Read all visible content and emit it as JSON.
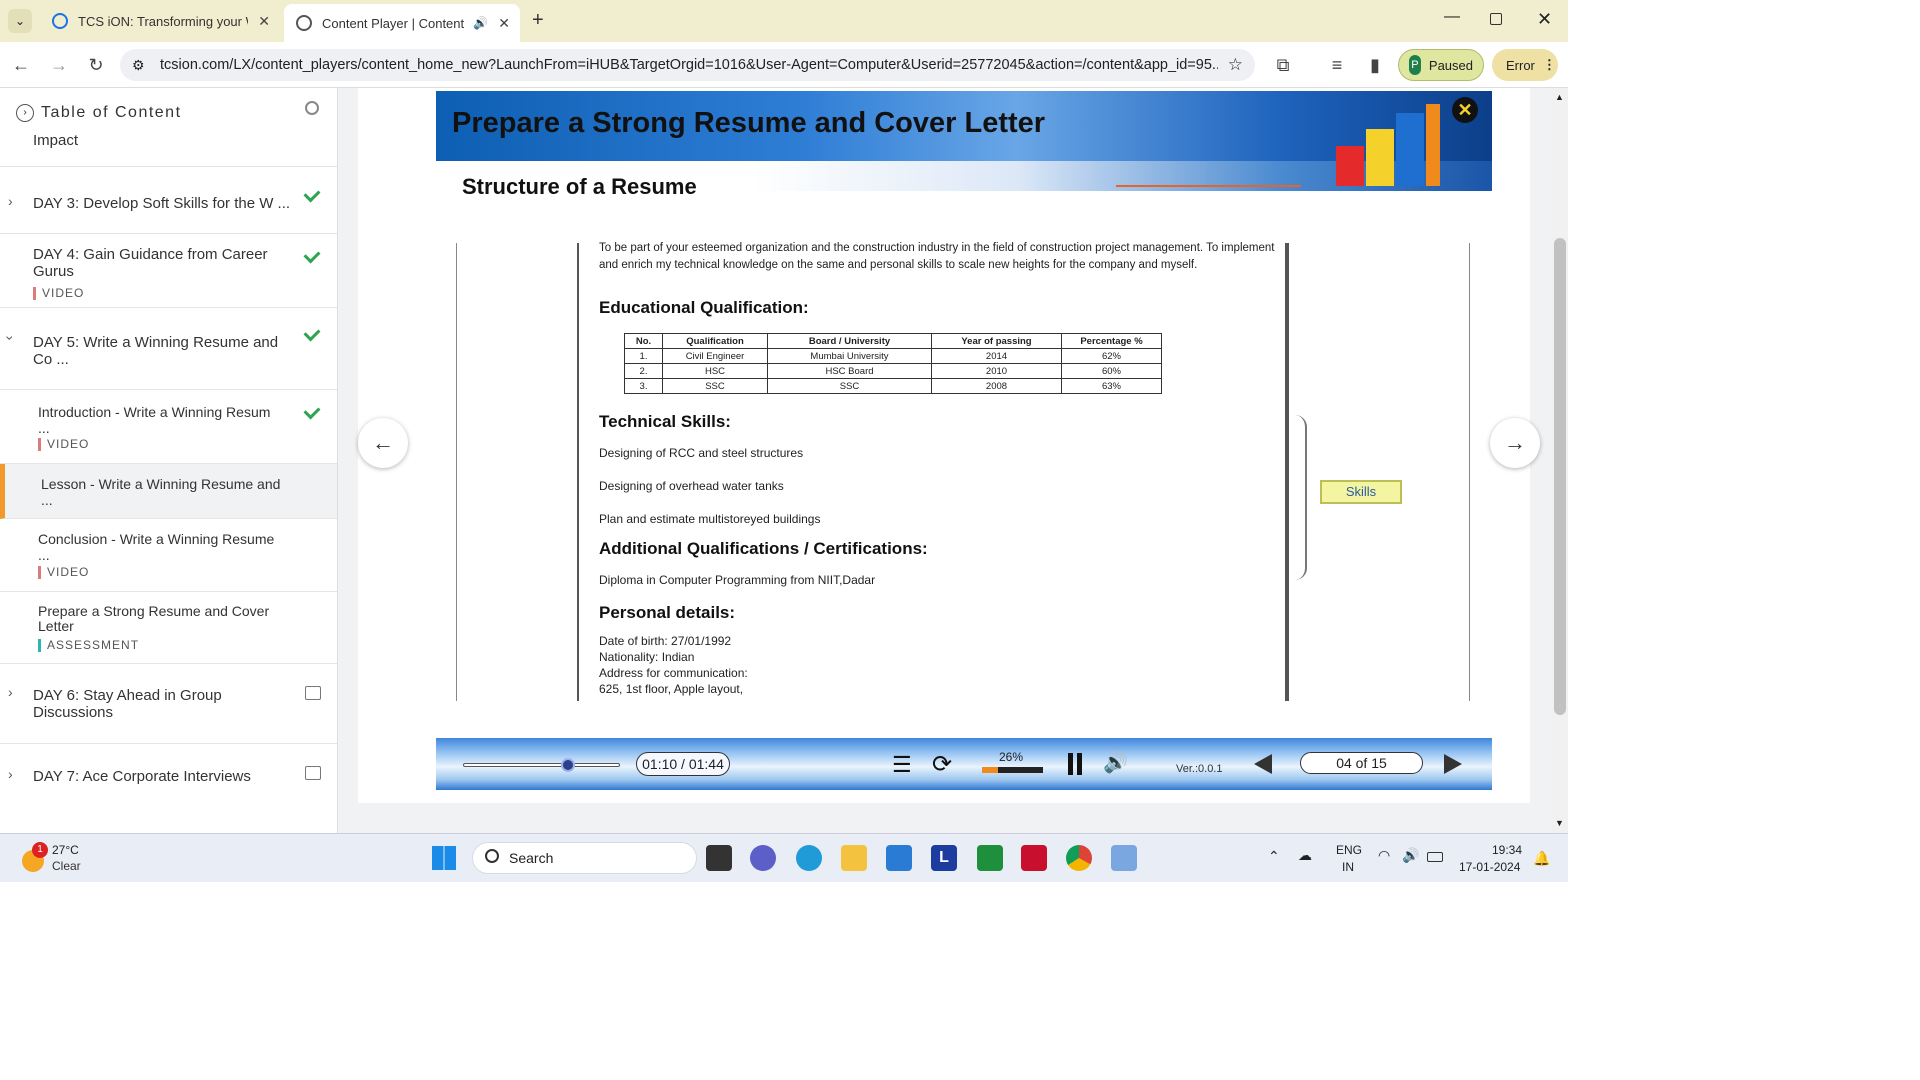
{
  "browser": {
    "tabs": [
      {
        "title": "TCS iON: Transforming your Wo",
        "active": false
      },
      {
        "title": "Content Player | Content",
        "active": true
      }
    ],
    "url": "tcsion.com/LX/content_players/content_home_new?LaunchFrom=iHUB&TargetOrgid=1016&User-Agent=Computer&Userid=25772045&action=/content&app_id=95...",
    "profile_initial": "P",
    "profile_status": "Paused",
    "error_label": "Error"
  },
  "sidebar": {
    "title": "Table of Content",
    "top_text": "Impact",
    "items": [
      {
        "label": "DAY 3: Develop Soft Skills for the W ...",
        "done": true
      },
      {
        "label": "DAY 4: Gain Guidance from Career Gurus",
        "tag": "VIDEO",
        "done": true
      },
      {
        "label": "DAY 5: Write a Winning Resume and Co ...",
        "done": true
      },
      {
        "label": "Introduction - Write a Winning Resum ...",
        "tag": "VIDEO",
        "done": true
      },
      {
        "label": "Lesson - Write a Winning Resume and ...",
        "active": true
      },
      {
        "label": "Conclusion - Write a Winning Resume ...",
        "tag": "VIDEO"
      },
      {
        "label": "Prepare a Strong Resume and Cover Letter",
        "tag": "ASSESSMENT"
      },
      {
        "label": "DAY 6: Stay Ahead in Group Discussions"
      },
      {
        "label": "DAY 7: Ace Corporate Interviews"
      }
    ]
  },
  "slide": {
    "banner_title": "Prepare a Strong Resume and Cover Letter",
    "subtitle": "Structure of a Resume",
    "objective": "To be part of your esteemed organization and the construction industry in the field of construction project management. To implement and enrich my technical knowledge on the same and personal skills to scale new heights for the company and myself.",
    "edu_heading": "Educational Qualification:",
    "table_headers": [
      "No.",
      "Qualification",
      "Board / University",
      "Year of passing",
      "Percentage %"
    ],
    "table_rows": [
      [
        "1.",
        "Civil Engineer",
        "Mumbai University",
        "2014",
        "62%"
      ],
      [
        "2.",
        "HSC",
        "HSC Board",
        "2010",
        "60%"
      ],
      [
        "3.",
        "SSC",
        "SSC",
        "2008",
        "63%"
      ]
    ],
    "tech_heading": "Technical Skills:",
    "tech_items": [
      "Designing of RCC and steel structures",
      "Designing of overhead water tanks",
      "Plan and estimate multistoreyed buildings"
    ],
    "addl_heading": "Additional Qualifications / Certifications:",
    "addl_item": "Diploma in Computer Programming from NIIT,Dadar",
    "personal_heading": "Personal details:",
    "personal_lines": [
      "Date of birth: 27/01/1992",
      "Nationality: Indian",
      "Address for communication:",
      "625, 1st floor, Apple layout,"
    ],
    "callout": "Skills"
  },
  "player": {
    "time": "01:10 / 01:44",
    "progress_fraction": 0.67,
    "volume_percent": "26%",
    "version": "Ver.:0.0.1",
    "page": "04 of 15"
  },
  "taskbar": {
    "temp": "27°C",
    "weather": "Clear",
    "weather_badge": "1",
    "search": "Search",
    "lang1": "ENG",
    "lang2": "IN",
    "time": "19:34",
    "date": "17-01-2024"
  }
}
